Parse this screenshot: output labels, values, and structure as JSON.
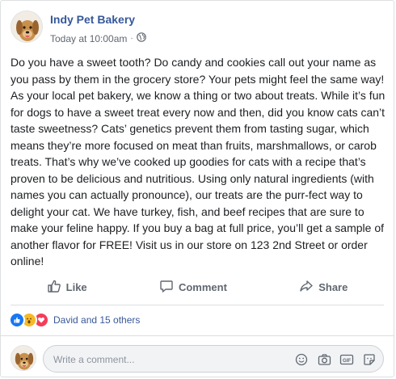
{
  "post": {
    "page_name": "Indy Pet Bakery",
    "timestamp": "Today at 10:00am",
    "separator": "·",
    "audience_icon": "globe-icon",
    "text": "Do you have a sweet tooth? Do candy and cookies call out your name as you pass by them in the grocery store? Your pets might feel the same way! As your local pet bakery, we know a thing or two about treats. While it’s fun for dogs to have a sweet treat every now and then, did you know cats can’t taste sweetness? Cats’ genetics prevent them from tasting sugar, which means they’re more focused on meat than fruits, marshmallows, or carob treats. That’s why we’ve cooked up goodies for cats with a recipe that’s proven to be delicious and nutritious. Using only natural ingredients (with names you can actually pronounce), our treats are the purr-fect way to delight your cat. We have turkey, fish, and beef recipes that are sure to make your feline happy. If you buy a bag at full price, you’ll get a sample of another flavor for FREE! Visit us in our store on 123 2nd Street or order online!"
  },
  "actions": {
    "like_label": "Like",
    "comment_label": "Comment",
    "share_label": "Share"
  },
  "reactions": {
    "icons": [
      "like-icon",
      "wow-icon",
      "love-icon"
    ],
    "summary": "David and 15 others"
  },
  "comment_box": {
    "placeholder": "Write a comment...",
    "tools": [
      "emoji-icon",
      "camera-icon",
      "gif-icon",
      "sticker-icon"
    ]
  },
  "colors": {
    "link_blue": "#365899",
    "muted_text": "#616770",
    "action_text": "#606770",
    "like_blue": "#1877f2",
    "wow_yellow": "#f7b928",
    "love_red": "#f33e58"
  }
}
